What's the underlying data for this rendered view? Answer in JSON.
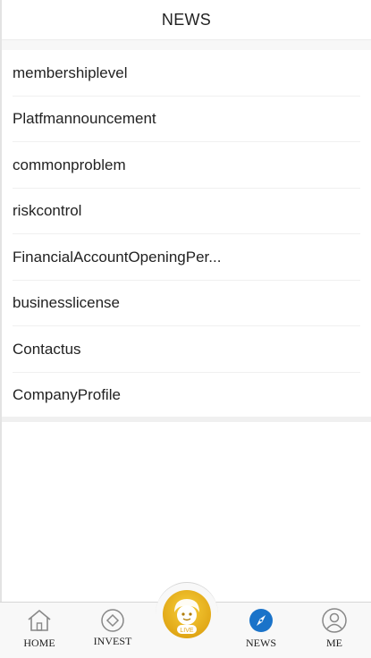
{
  "header": {
    "title": "NEWS"
  },
  "menu": {
    "items": [
      {
        "label": "membershiplevel"
      },
      {
        "label": "Platfmannouncement"
      },
      {
        "label": "commonproblem"
      },
      {
        "label": "riskcontrol"
      },
      {
        "label": "FinancialAccountOpeningPer..."
      },
      {
        "label": "businesslicense"
      },
      {
        "label": "Contactus"
      },
      {
        "label": "CompanyProfile"
      }
    ]
  },
  "tabbar": {
    "home": {
      "label": "HOME",
      "icon": "home-icon"
    },
    "invest": {
      "label": "INVEST",
      "icon": "diamond-icon"
    },
    "live": {
      "label": "LIVE",
      "icon": "live-avatar-icon",
      "color": "#e9b31c"
    },
    "news": {
      "label": "NEWS",
      "icon": "compass-icon",
      "color": "#1a73c9"
    },
    "me": {
      "label": "ME",
      "icon": "user-icon"
    }
  }
}
